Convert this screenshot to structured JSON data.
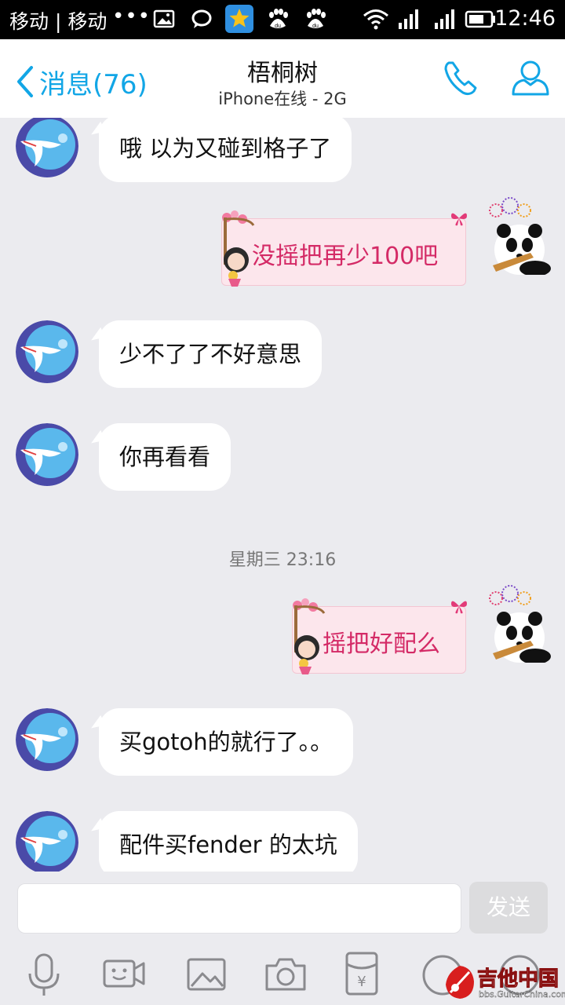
{
  "status_bar": {
    "carrier": "移动 | 移动",
    "more": "•••",
    "time": "12:46",
    "icons": [
      "image-icon",
      "chat-icon",
      "star-app-icon",
      "baidu-icon",
      "baidu-icon",
      "wifi-icon",
      "signal-icon",
      "signal-icon",
      "battery-icon"
    ]
  },
  "header": {
    "back_label": "消息(76)",
    "title": "梧桐树",
    "subtitle": "iPhone在线 - 2G",
    "accent": "#12a6e6"
  },
  "messages": [
    {
      "side": "left",
      "text": "哦 以为又碰到格子了"
    },
    {
      "side": "right",
      "text": "没摇把再少100吧"
    },
    {
      "side": "left",
      "text": "少不了了不好意思"
    },
    {
      "side": "left",
      "text": "你再看看"
    },
    {
      "side": "time",
      "text": "星期三 23:16"
    },
    {
      "side": "right",
      "text": "摇把好配么"
    },
    {
      "side": "left",
      "text": "买gotoh的就行了。。"
    },
    {
      "side": "left",
      "text": "配件买fender 的太坑"
    }
  ],
  "input": {
    "placeholder": "",
    "send_label": "发送"
  },
  "toolbar": {
    "items": [
      "microphone-icon",
      "video-icon",
      "image-icon",
      "camera-icon",
      "red-packet-icon",
      "emoji-icon",
      "more-icon"
    ]
  },
  "watermark": {
    "text": "吉他中国",
    "sub": "bbs.GuitarChina.com"
  }
}
